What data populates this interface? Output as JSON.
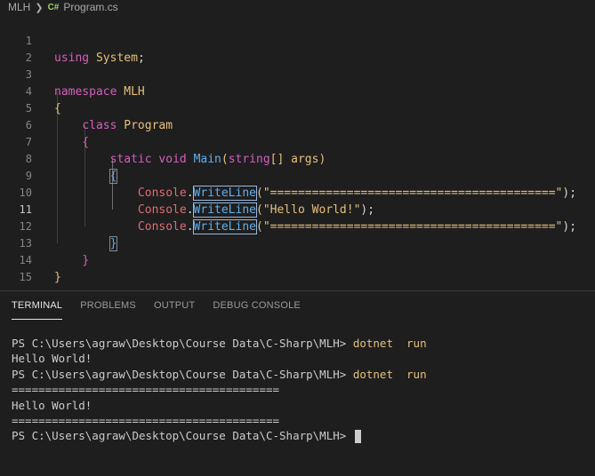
{
  "breadcrumb": {
    "folder": "MLH",
    "file_icon": "C#",
    "file": "Program.cs"
  },
  "editor": {
    "current_line": 11,
    "line_numbers": [
      "1",
      "2",
      "3",
      "4",
      "5",
      "6",
      "7",
      "8",
      "9",
      "10",
      "11",
      "12",
      "13",
      "14",
      "15"
    ],
    "tokens": {
      "using": "using",
      "system": "System",
      "semicolon": ";",
      "namespace": "namespace",
      "ns_name": "MLH",
      "open_brace": "{",
      "close_brace": "}",
      "class": "class",
      "class_name": "Program",
      "static": "static",
      "void": "void",
      "main": "Main",
      "paren_open": "(",
      "string_type": "string",
      "array_args": "[] args",
      "paren_close": ")",
      "console": "Console",
      "dot": ".",
      "writeline": "WriteLine",
      "str_rule": "\"=========================================\"",
      "str_hello": "\"Hello World!\"",
      "stmt_end": ");"
    }
  },
  "panel": {
    "tabs": [
      "TERMINAL",
      "PROBLEMS",
      "OUTPUT",
      "DEBUG CONSOLE"
    ],
    "active_tab": "TERMINAL"
  },
  "terminal": {
    "prompt": "PS C:\\Users\\agraw\\Desktop\\Course Data\\C-Sharp\\MLH> ",
    "command": "dotnet  run",
    "hello": "Hello World!",
    "rule": "========================================"
  }
}
